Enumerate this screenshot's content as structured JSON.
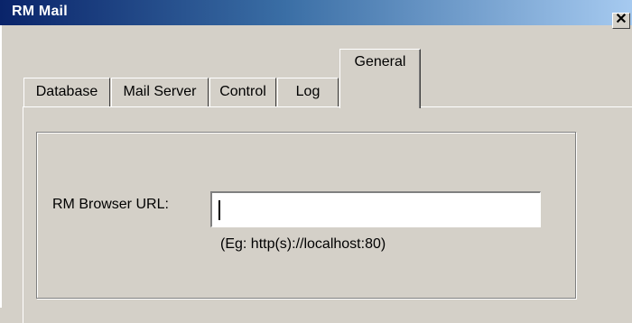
{
  "window": {
    "title": "RM Mail",
    "close_glyph": "✕"
  },
  "tabs": [
    {
      "label": "Database",
      "selected": false
    },
    {
      "label": "Mail Server",
      "selected": false
    },
    {
      "label": "Control",
      "selected": false
    },
    {
      "label": "Log",
      "selected": false
    },
    {
      "label": "General",
      "selected": true
    }
  ],
  "general": {
    "url_label": "RM Browser URL:",
    "url_value": "",
    "url_hint": "(Eg: http(s)://localhost:80)"
  },
  "colors": {
    "title_gradient_start": "#0a246a",
    "title_gradient_end": "#a6caf0",
    "dialog_face": "#d4d0c8"
  }
}
